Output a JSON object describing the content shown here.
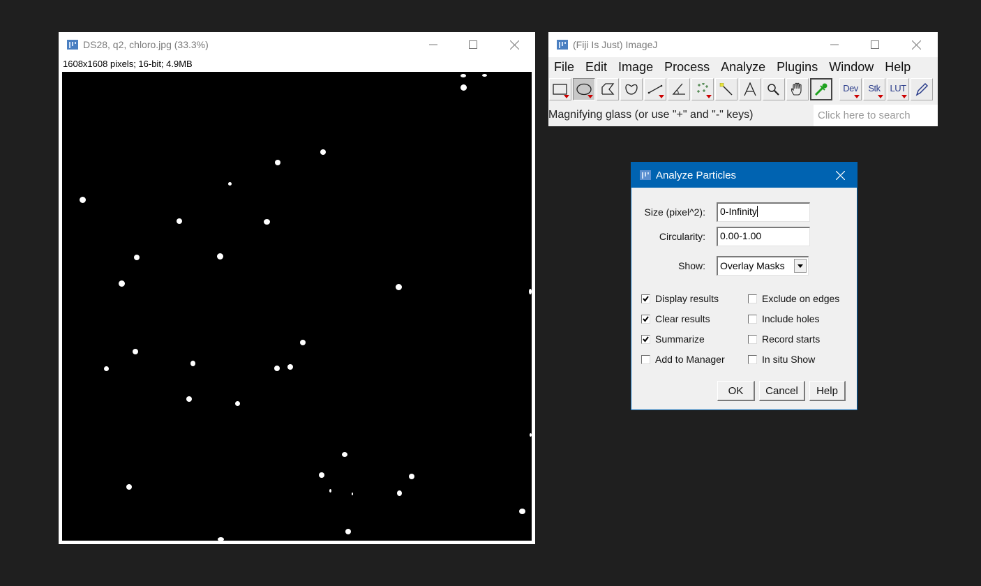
{
  "image_window": {
    "title": "DS28, q2, chloro.jpg (33.3%)",
    "info": "1608x1608 pixels; 16-bit; 4.9MB",
    "controls": [
      "minimize",
      "maximize",
      "close"
    ],
    "particle_count_visible": 33
  },
  "imagej_window": {
    "title": "(Fiji Is Just) ImageJ",
    "menus": [
      "File",
      "Edit",
      "Image",
      "Process",
      "Analyze",
      "Plugins",
      "Window",
      "Help"
    ],
    "tools": [
      {
        "name": "rectangle-tool",
        "selected": false
      },
      {
        "name": "oval-tool",
        "selected": true
      },
      {
        "name": "polygon-tool",
        "selected": false
      },
      {
        "name": "freehand-tool",
        "selected": false
      },
      {
        "name": "line-tool",
        "selected": false
      },
      {
        "name": "angle-tool",
        "selected": false
      },
      {
        "name": "multipoint-tool",
        "selected": false
      },
      {
        "name": "wand-tool",
        "selected": false
      },
      {
        "name": "text-tool",
        "selected": false
      },
      {
        "name": "magnifying-glass-tool",
        "selected": false
      },
      {
        "name": "scrolling-tool",
        "selected": false
      },
      {
        "name": "color-picker-tool",
        "selected": false
      }
    ],
    "menu_tools": [
      "Dev",
      "Stk",
      "LUT"
    ],
    "status": "Magnifying glass (or use \"+\" and \"-\" keys)",
    "search_placeholder": "Click here to search"
  },
  "dialog": {
    "title": "Analyze Particles",
    "size_label": "Size (pixel^2):",
    "size_value": "0-Infinity",
    "circularity_label": "Circularity:",
    "circularity_value": "0.00-1.00",
    "show_label": "Show:",
    "show_value": "Overlay Masks",
    "checkboxes_left": [
      {
        "label": "Display results",
        "checked": true
      },
      {
        "label": "Clear results",
        "checked": true
      },
      {
        "label": "Summarize",
        "checked": true
      },
      {
        "label": "Add to Manager",
        "checked": false
      }
    ],
    "checkboxes_right": [
      {
        "label": "Exclude on edges",
        "checked": false
      },
      {
        "label": "Include holes",
        "checked": false
      },
      {
        "label": "Record starts",
        "checked": false
      },
      {
        "label": "In situ Show",
        "checked": false
      }
    ],
    "buttons": {
      "ok": "OK",
      "cancel": "Cancel",
      "help": "Help"
    }
  },
  "colors": {
    "desktop": "#1f1f1f",
    "dialog_titlebar": "#0063b1",
    "canvas_bg": "#000000",
    "particle": "#ffffff"
  }
}
